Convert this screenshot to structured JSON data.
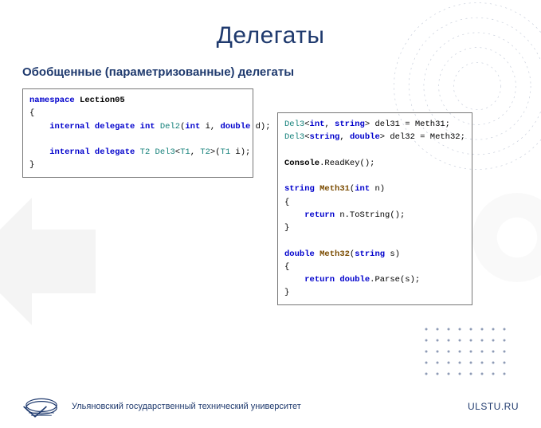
{
  "title": "Делегаты",
  "subtitle": "Обобщенные (параметризованные) делегаты",
  "footer": {
    "university": "Ульяновский государственный технический университет",
    "url": "ULSTU.RU"
  },
  "code_left": {
    "lines": [
      {
        "tokens": [
          [
            "kw",
            "namespace"
          ],
          [
            "id",
            " Lection05"
          ]
        ]
      },
      {
        "tokens": [
          [
            "",
            "{"
          ]
        ]
      },
      {
        "tokens": [
          [
            "",
            "    "
          ],
          [
            "kw",
            "internal delegate int"
          ],
          [
            "type",
            " Del2"
          ],
          [
            "",
            "("
          ],
          [
            "kw",
            "int"
          ],
          [
            "",
            " i, "
          ],
          [
            "kw",
            "double"
          ],
          [
            "",
            " d);"
          ]
        ]
      },
      {
        "tokens": [
          [
            "",
            ""
          ]
        ]
      },
      {
        "tokens": [
          [
            "",
            "    "
          ],
          [
            "kw",
            "internal delegate"
          ],
          [
            "type",
            " T2 Del3"
          ],
          [
            "",
            "<"
          ],
          [
            "type",
            "T1"
          ],
          [
            "",
            ", "
          ],
          [
            "type",
            "T2"
          ],
          [
            "",
            ">("
          ],
          [
            "type",
            "T1"
          ],
          [
            "",
            " i);"
          ]
        ]
      },
      {
        "tokens": [
          [
            "",
            "}"
          ]
        ]
      }
    ]
  },
  "code_right": {
    "lines": [
      {
        "tokens": [
          [
            "type",
            "Del3"
          ],
          [
            "",
            "<"
          ],
          [
            "kw",
            "int"
          ],
          [
            "",
            ", "
          ],
          [
            "kw",
            "string"
          ],
          [
            "",
            "> del31 = Meth31;"
          ]
        ]
      },
      {
        "tokens": [
          [
            "type",
            "Del3"
          ],
          [
            "",
            "<"
          ],
          [
            "kw",
            "string"
          ],
          [
            "",
            ", "
          ],
          [
            "kw",
            "double"
          ],
          [
            "",
            "> del32 = Meth32;"
          ]
        ]
      },
      {
        "tokens": [
          [
            "",
            ""
          ]
        ]
      },
      {
        "tokens": [
          [
            "id",
            "Console"
          ],
          [
            "",
            ".ReadKey();"
          ]
        ]
      },
      {
        "tokens": [
          [
            "",
            ""
          ]
        ]
      },
      {
        "tokens": [
          [
            "kw",
            "string"
          ],
          [
            "method",
            " Meth31"
          ],
          [
            "",
            "("
          ],
          [
            "kw",
            "int"
          ],
          [
            "",
            " n)"
          ]
        ]
      },
      {
        "tokens": [
          [
            "",
            "{"
          ]
        ]
      },
      {
        "tokens": [
          [
            "",
            "    "
          ],
          [
            "kw",
            "return"
          ],
          [
            "",
            " n.ToString();"
          ]
        ]
      },
      {
        "tokens": [
          [
            "",
            "}"
          ]
        ]
      },
      {
        "tokens": [
          [
            "",
            ""
          ]
        ]
      },
      {
        "tokens": [
          [
            "kw",
            "double"
          ],
          [
            "method",
            " Meth32"
          ],
          [
            "",
            "("
          ],
          [
            "kw",
            "string"
          ],
          [
            "",
            " s)"
          ]
        ]
      },
      {
        "tokens": [
          [
            "",
            "{"
          ]
        ]
      },
      {
        "tokens": [
          [
            "",
            "    "
          ],
          [
            "kw",
            "return"
          ],
          [
            "",
            " "
          ],
          [
            "kw",
            "double"
          ],
          [
            "",
            ".Parse(s);"
          ]
        ]
      },
      {
        "tokens": [
          [
            "",
            "}"
          ]
        ]
      }
    ]
  }
}
